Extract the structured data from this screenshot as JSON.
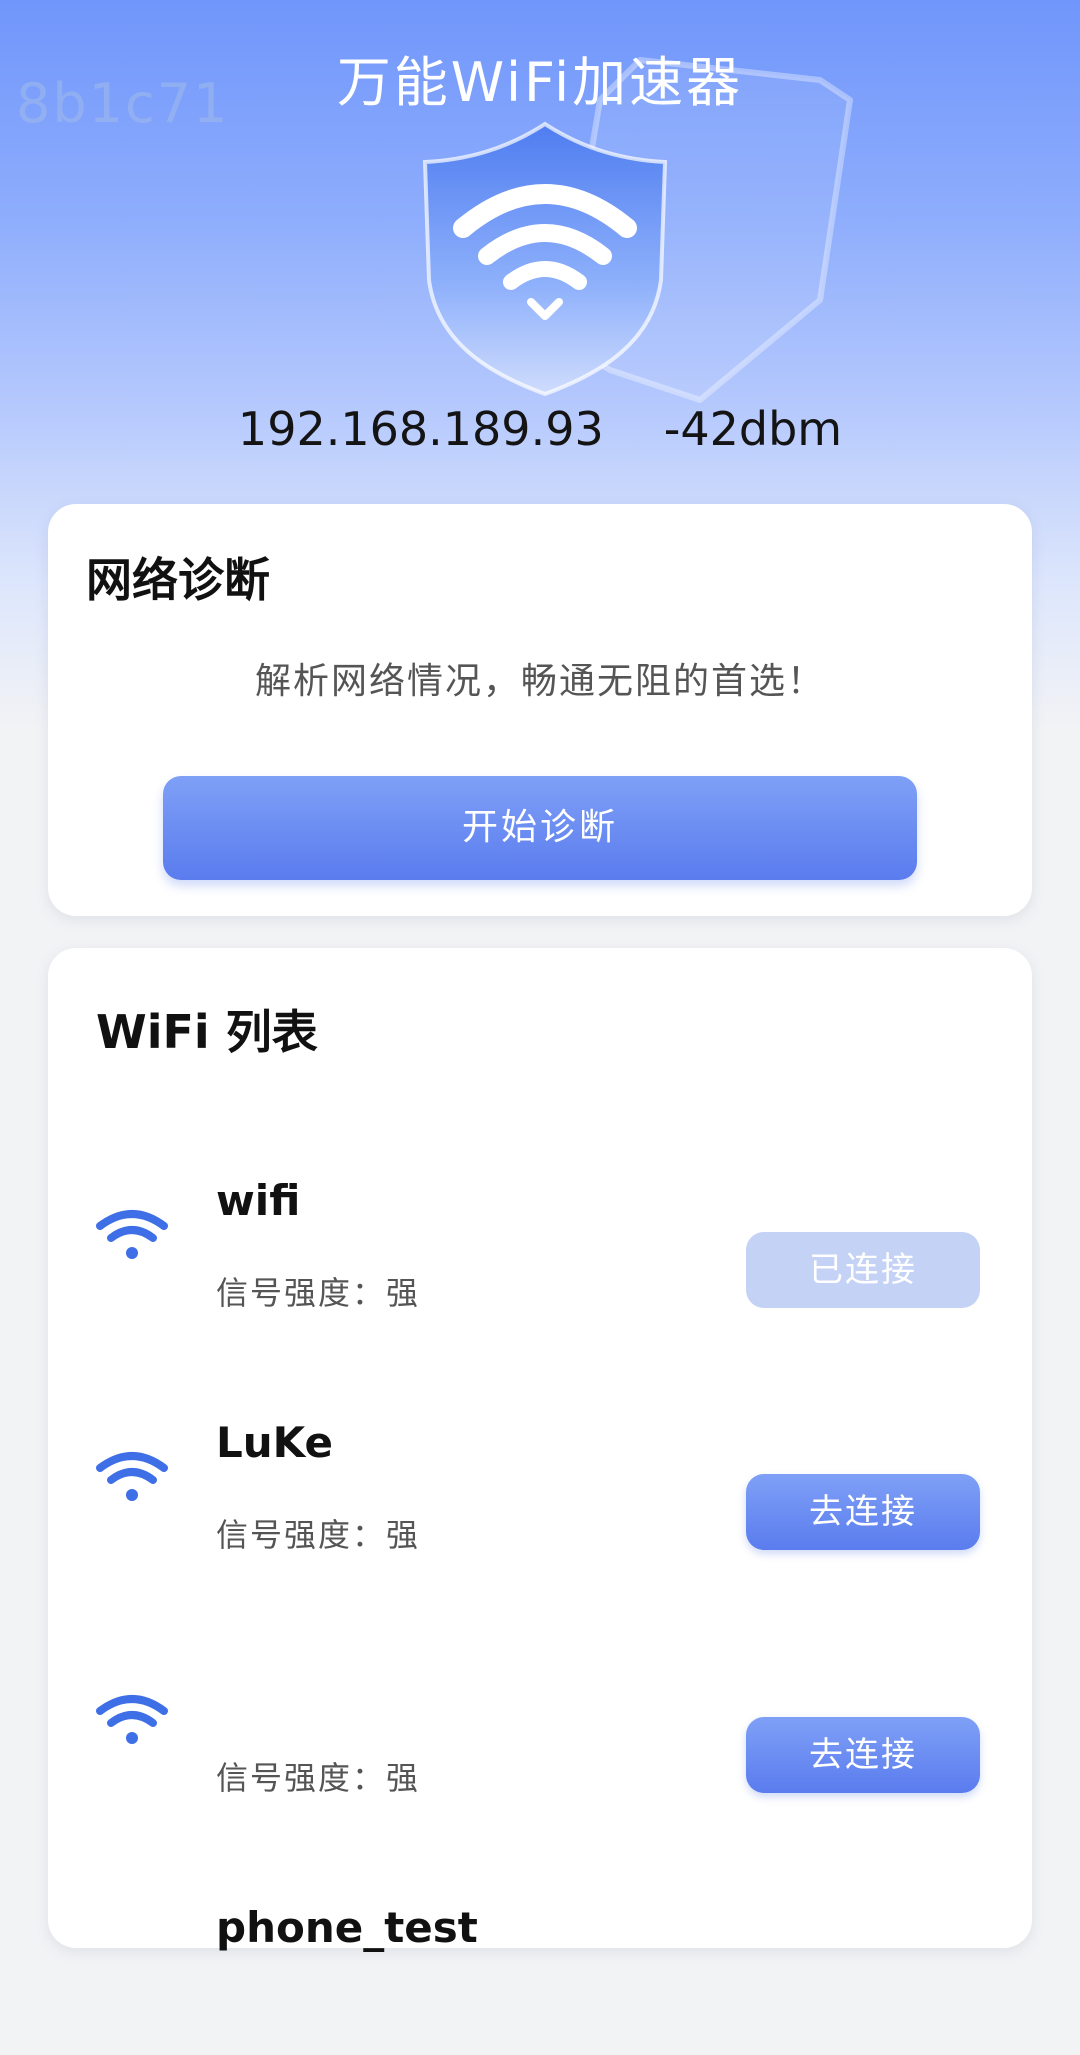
{
  "watermark": "8b1c71",
  "app": {
    "title": "万能WiFi加速器"
  },
  "status": {
    "ip": "192.168.189.93",
    "signal_dbm": "-42dbm"
  },
  "diagnosis": {
    "title": "网络诊断",
    "subtitle": "解析网络情况，畅通无阻的首选！",
    "button": "开始诊断"
  },
  "wifi_list": {
    "title": "WiFi 列表",
    "items": [
      {
        "name": "wifi",
        "signal": "信号强度：强",
        "button": "已连接",
        "connected": true
      },
      {
        "name": "LuKe",
        "signal": "信号强度：强",
        "button": "去连接",
        "connected": false
      },
      {
        "name": "",
        "signal": "信号强度：强",
        "button": "去连接",
        "connected": false
      },
      {
        "name": "phone_test",
        "signal": "",
        "button": "",
        "connected": false
      }
    ]
  },
  "colors": {
    "accent": "#5a7cee",
    "wifi_icon": "#3f6fe6",
    "connected_btn": "#c4d2f6"
  },
  "icons": {
    "shield": "shield-wifi-icon",
    "wifi": "wifi-icon"
  }
}
